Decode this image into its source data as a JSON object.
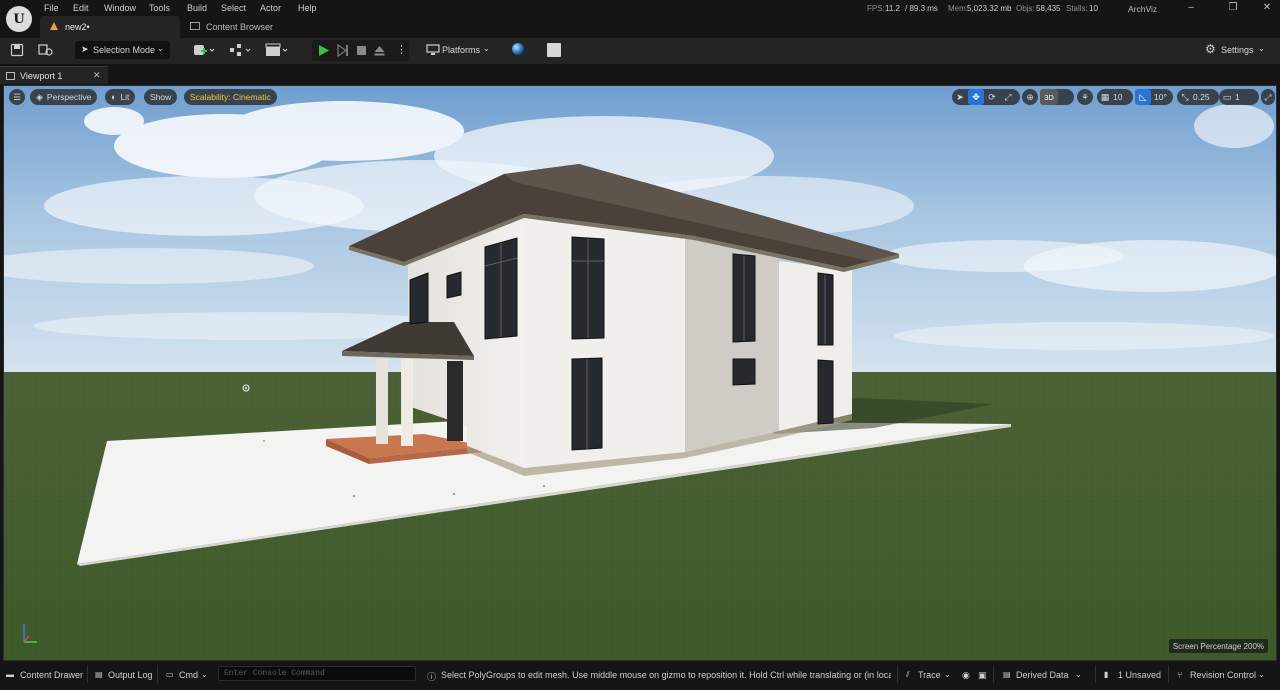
{
  "menubar": {
    "items": [
      "File",
      "Edit",
      "Window",
      "Tools",
      "Build",
      "Select",
      "Actor",
      "Help"
    ],
    "doc_tab": "new2•",
    "content_browser_tab": "Content Browser",
    "stats": {
      "fps_label": "FPS:",
      "fps_value": "11.2",
      "ms_value": "/ 89.3 ms",
      "mem_label": "Mem:",
      "mem_value": "5,023.32 mb",
      "objs_label": "Objs:",
      "objs_value": "58,435",
      "stalls_label": "Stalls:",
      "stalls_value": "10"
    },
    "project": "ArchViz"
  },
  "toolbar": {
    "selection_mode": "Selection Mode",
    "platforms": "Platforms",
    "settings": "Settings"
  },
  "viewport_tab": {
    "label": "Viewport 1"
  },
  "viewport": {
    "perspective": "Perspective",
    "lit": "Lit",
    "show": "Show",
    "scalability": "Scalability: Cinematic",
    "grid_value": "10",
    "rot_value": "10°",
    "scale_value": "0.25",
    "cam_speed": "1",
    "three_d": "3D",
    "screen_percentage": "Screen Percentage  200%"
  },
  "statusbar": {
    "content_drawer": "Content Drawer",
    "output_log": "Output Log",
    "cmd": "Cmd",
    "console_placeholder": "Enter Console Command",
    "hint": "Select PolyGroups to edit mesh. Use middle mouse on gizmo to reposition it. Hold Ctrl while translating or (in local mod",
    "trace": "Trace",
    "derived_data": "Derived Data",
    "unsaved": "1 Unsaved",
    "revision_control": "Revision Control"
  },
  "colors": {
    "accent_blue": "#2a74d4",
    "play_green": "#3fbf3f",
    "scalability_yellow": "#f0c64a",
    "editor_bg": "#151515",
    "toolbar_bg": "#242424"
  }
}
